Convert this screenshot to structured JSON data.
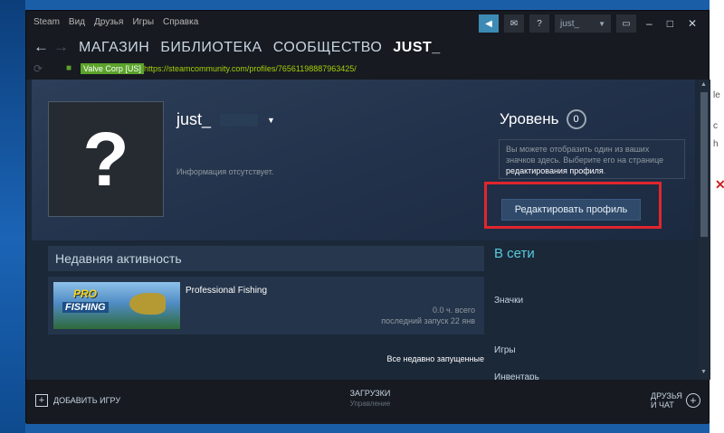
{
  "menubar": {
    "items": [
      "Steam",
      "Вид",
      "Друзья",
      "Игры",
      "Справка"
    ],
    "account_name": "just_",
    "help_label": "?"
  },
  "nav": {
    "tabs": [
      "МАГАЗИН",
      "БИБЛИОТЕКА",
      "СООБЩЕСТВО",
      "JUST_"
    ],
    "active_tab": "JUST_"
  },
  "urlbar": {
    "cert": "Valve Corp [US]",
    "url": "https://steamcommunity.com/profiles/76561198887963425/"
  },
  "profile": {
    "persona_name": "just_",
    "no_info": "Информация отсутствует.",
    "level_label": "Уровень",
    "level_value": "0",
    "badge_hint_text": "Вы можете отобразить один из ваших значков здесь. Выберите его на странице ",
    "badge_hint_link": "редактирования профиля",
    "badge_hint_end": ".",
    "edit_button": "Редактировать профиль"
  },
  "activity": {
    "header": "Недавняя активность",
    "game": {
      "name": "Professional Fishing",
      "capsule_top": "PRO",
      "capsule_bottom": "FISHING",
      "hours": "0.0 ч. всего",
      "last_played": "последний запуск 22 янв"
    },
    "all_recent": "Все недавно запущенные"
  },
  "sidebar": {
    "status": "В сети",
    "links": [
      "Значки",
      "Игры",
      "Инвентарь"
    ]
  },
  "bottombar": {
    "add_game": "ДОБАВИТЬ ИГРУ",
    "downloads": "ЗАГРУЗКИ",
    "downloads_sub": "Управление",
    "friends_line1": "ДРУЗЬЯ",
    "friends_line2": "И ЧАТ"
  },
  "colors": {
    "accent_blue": "#3d8bb5",
    "online": "#57cbde",
    "highlight": "#e0262d",
    "cert_green": "#5ba32b",
    "url_green": "#a4d007"
  },
  "icons": [
    "back-arrow-icon",
    "forward-arrow-icon",
    "refresh-icon",
    "lock-icon",
    "plus-icon",
    "add-friend-icon",
    "dropdown-caret-icon"
  ]
}
